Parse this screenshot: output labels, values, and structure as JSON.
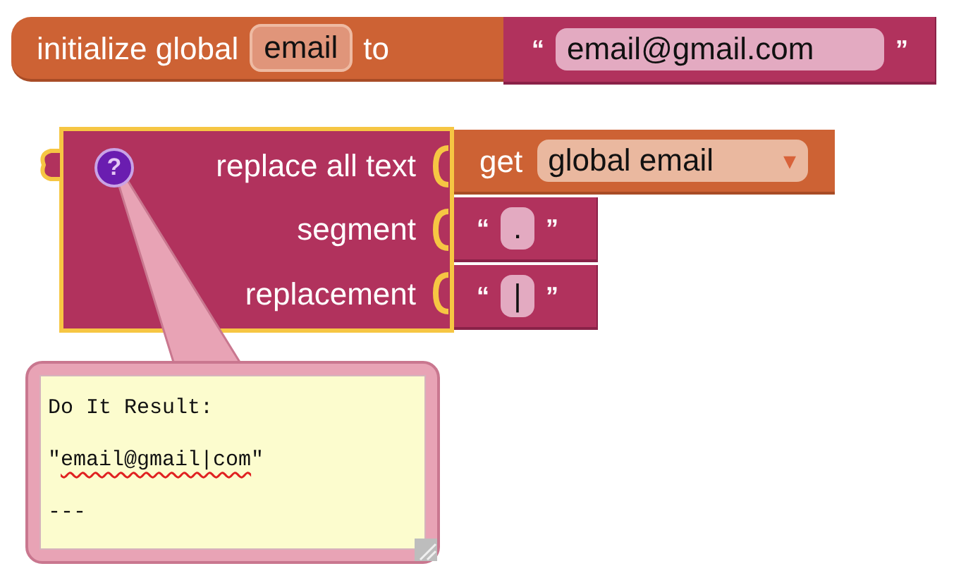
{
  "init_block": {
    "keyword": "initialize global",
    "name": "email",
    "connector": "to",
    "value_block": {
      "open_quote": "“",
      "text": "email@gmail.com",
      "close_quote": "”"
    }
  },
  "replace_block": {
    "selected": true,
    "help_icon": "?",
    "sockets": [
      {
        "label": "replace all text",
        "input": {
          "kind": "getter",
          "keyword": "get",
          "dropdown": "global email",
          "caret": "▾"
        }
      },
      {
        "label": "segment",
        "input": {
          "kind": "string",
          "open_quote": "“",
          "text": ".",
          "close_quote": "”"
        }
      },
      {
        "label": "replacement",
        "input": {
          "kind": "string",
          "open_quote": "“",
          "text": "|",
          "close_quote": "”"
        }
      }
    ]
  },
  "comment": {
    "lines": [
      [
        {
          "text": "Do It Result:",
          "spell_error": false
        }
      ],
      [
        {
          "text": "\"",
          "spell_error": false
        },
        {
          "text": "email@gmail|com",
          "spell_error": true
        },
        {
          "text": "\"",
          "spell_error": false
        }
      ],
      [
        {
          "text": "---",
          "spell_error": false
        }
      ]
    ]
  }
}
